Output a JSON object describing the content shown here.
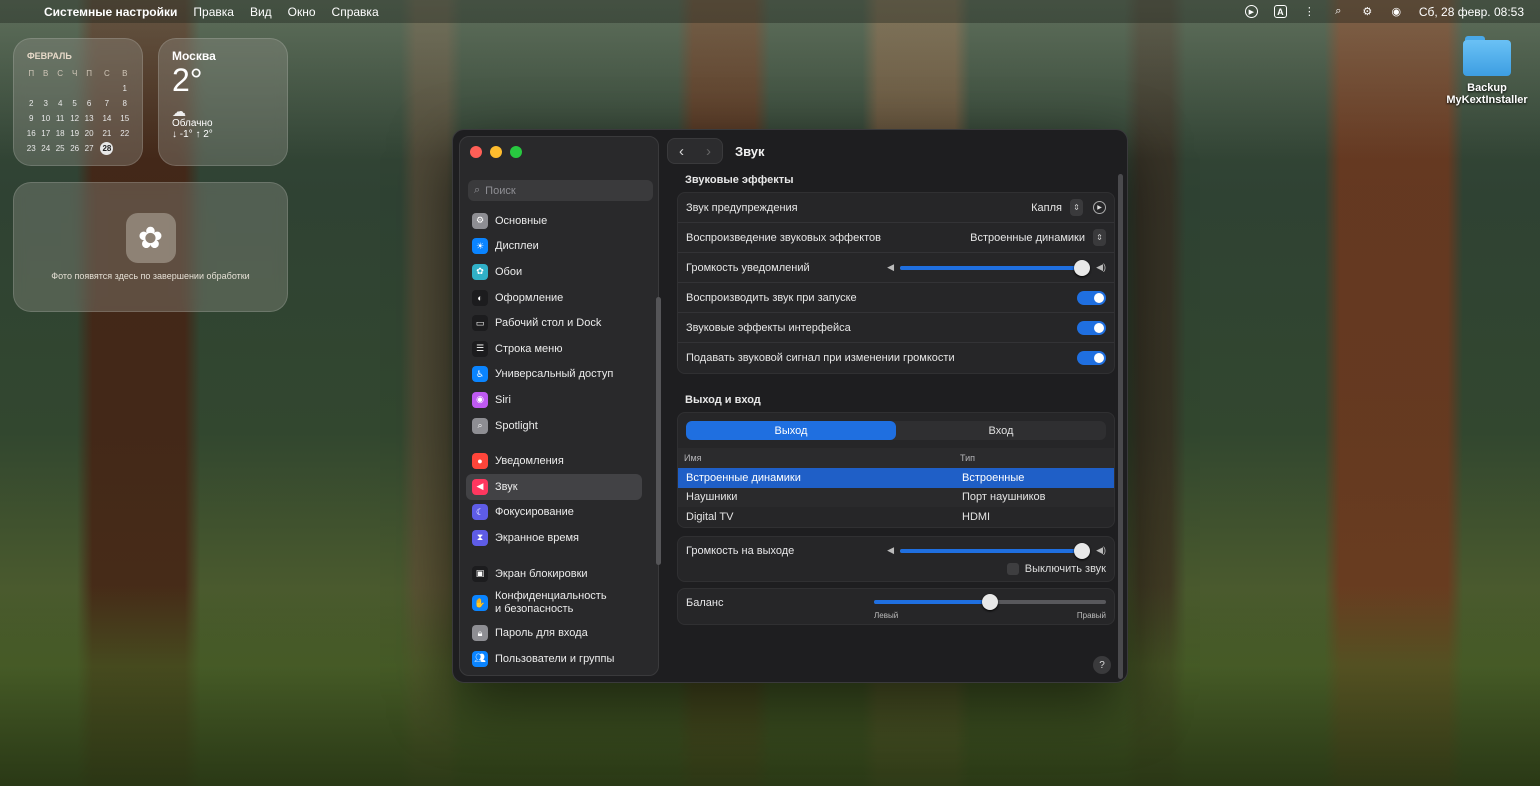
{
  "menubar": {
    "app": "Системные настройки",
    "items": [
      "Правка",
      "Вид",
      "Окно",
      "Справка"
    ],
    "clock": "Сб, 28 февр. 08:53"
  },
  "calendar": {
    "month": "ФЕВРАЛЬ",
    "weekdays": [
      "П",
      "В",
      "С",
      "Ч",
      "П",
      "С",
      "В"
    ],
    "weeks": [
      [
        "",
        "",
        "",
        "",
        "",
        "",
        "1"
      ],
      [
        "2",
        "3",
        "4",
        "5",
        "6",
        "7",
        "8"
      ],
      [
        "9",
        "10",
        "11",
        "12",
        "13",
        "14",
        "15"
      ],
      [
        "16",
        "17",
        "18",
        "19",
        "20",
        "21",
        "22"
      ],
      [
        "23",
        "24",
        "25",
        "26",
        "27",
        "28",
        ""
      ]
    ],
    "today": "28"
  },
  "weather": {
    "city": "Москва",
    "temp": "2°",
    "condition": "Облачно",
    "range": "↓ -1° ↑ 2°"
  },
  "photos": {
    "message": "Фото появятся здесь по завершении обработки"
  },
  "desktop_icon": {
    "line1": "Backup",
    "line2": "MyKextInstaller"
  },
  "sidebar": {
    "search_placeholder": "Поиск",
    "items": [
      {
        "label": "Основные",
        "icon": "gear-icon",
        "color": "#8e8e93"
      },
      {
        "label": "Дисплеи",
        "icon": "sun-icon",
        "color": "#0a84ff"
      },
      {
        "label": "Обои",
        "icon": "flower-icon",
        "color": "#30b0c7"
      },
      {
        "label": "Оформление",
        "icon": "appearance-icon",
        "color": "#1c1c1e"
      },
      {
        "label": "Рабочий стол и Dock",
        "icon": "dock-icon",
        "color": "#1c1c1e"
      },
      {
        "label": "Строка меню",
        "icon": "menubar-icon",
        "color": "#1c1c1e"
      },
      {
        "label": "Универсальный доступ",
        "icon": "accessibility-icon",
        "color": "#0a84ff"
      },
      {
        "label": "Siri",
        "icon": "siri-icon",
        "color": "#bf5af2"
      },
      {
        "label": "Spotlight",
        "icon": "spotlight-icon",
        "color": "#8e8e93"
      },
      {
        "label": "Уведомления",
        "icon": "bell-icon",
        "color": "#ff453a"
      },
      {
        "label": "Звук",
        "icon": "speaker-icon",
        "color": "#ff375f"
      },
      {
        "label": "Фокусирование",
        "icon": "moon-icon",
        "color": "#5e5ce6"
      },
      {
        "label": "Экранное время",
        "icon": "hourglass-icon",
        "color": "#5e5ce6"
      },
      {
        "label": "Экран блокировки",
        "icon": "lock-screen-icon",
        "color": "#1c1c1e"
      },
      {
        "label": "Конфиденциальность",
        "label2": "и безопасность",
        "icon": "hand-icon",
        "color": "#0a84ff"
      },
      {
        "label": "Пароль для входа",
        "icon": "lock-icon",
        "color": "#8e8e93"
      },
      {
        "label": "Пользователи и группы",
        "icon": "users-icon",
        "color": "#0a84ff"
      }
    ]
  },
  "window": {
    "title": "Звук"
  },
  "sound_effects": {
    "section_title": "Звуковые эффекты",
    "alert_label": "Звук предупреждения",
    "alert_value": "Капля",
    "playback_label": "Воспроизведение звуковых эффектов",
    "playback_value": "Встроенные динамики",
    "notif_volume_label": "Громкость уведомлений",
    "notif_volume": 0.96,
    "startup_label": "Воспроизводить звук при запуске",
    "ui_effects_label": "Звуковые эффекты интерфейса",
    "volume_feedback_label": "Подавать звуковой сигнал при изменении громкости"
  },
  "output_input": {
    "section_title": "Выход и вход",
    "tab_output": "Выход",
    "tab_input": "Вход",
    "col_name": "Имя",
    "col_type": "Тип",
    "devices": [
      {
        "name": "Встроенные динамики",
        "type": "Встроенные"
      },
      {
        "name": "Наушники",
        "type": "Порт наушников"
      },
      {
        "name": "Digital TV",
        "type": "HDMI"
      }
    ],
    "output_volume_label": "Громкость на выходе",
    "output_volume": 0.96,
    "mute_label": "Выключить звук",
    "balance_label": "Баланс",
    "balance": 0.5,
    "balance_left": "Левый",
    "balance_right": "Правый"
  },
  "colors": {
    "accent": "#1f6fe0"
  }
}
